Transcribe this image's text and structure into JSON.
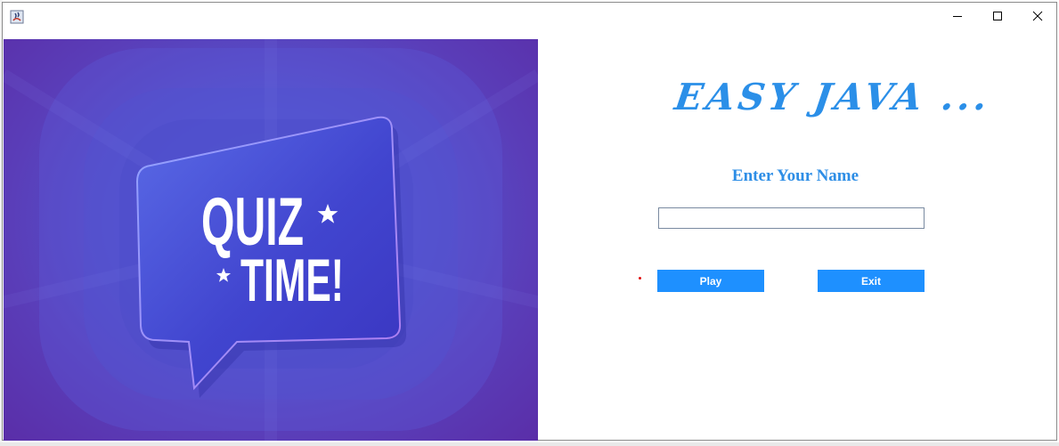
{
  "window": {
    "controls": {
      "minimize_icon": "minimize-icon",
      "maximize_icon": "maximize-icon",
      "close_icon": "close-icon"
    }
  },
  "banner": {
    "line1": "QUIZ",
    "line2": "TIME!",
    "colors": {
      "background": "#5a3fb8",
      "bubble": "#4b4fd6",
      "text": "#ffffff"
    }
  },
  "form": {
    "title": "EASY JAVA ...",
    "prompt": "Enter Your Name",
    "name_value": "",
    "play_label": "Play",
    "exit_label": "Exit",
    "accent_color": "#1e90ff"
  }
}
